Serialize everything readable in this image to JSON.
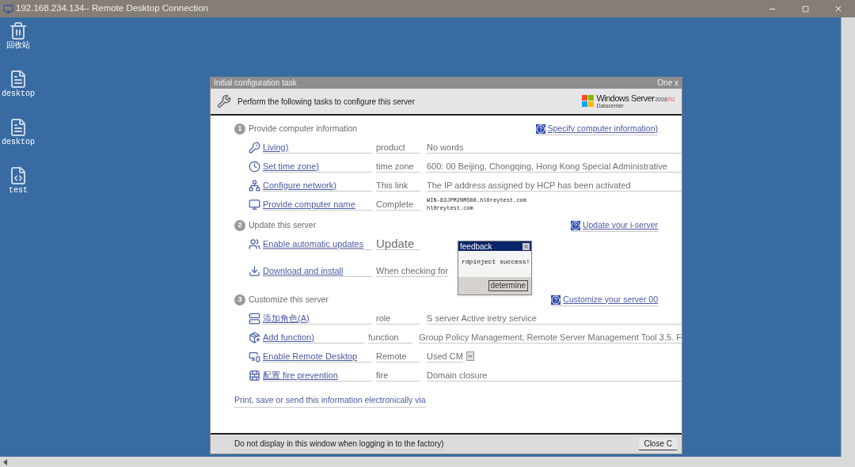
{
  "window": {
    "title": "192.168.234.134– Remote Desktop Connection"
  },
  "desktop_icons": [
    {
      "label": "回收站",
      "kind": "recycle"
    },
    {
      "label": "desktop",
      "kind": "file"
    },
    {
      "label": "desktop",
      "kind": "file"
    },
    {
      "label": "test",
      "kind": "script"
    }
  ],
  "dialog": {
    "title": "Initial configuration task",
    "close_label": "One x",
    "header_text": "Perform the following tasks to configure this server",
    "logo": {
      "brand": "Windows Server",
      "version": "2008",
      "edition": "R2",
      "sub": "Datacenter"
    },
    "sections": [
      {
        "number": "1",
        "title": "Provide computer information",
        "help_link": "Specify computer information)",
        "tasks": [
          {
            "kind": "key",
            "link": "Living)",
            "label": "product",
            "value": "No words"
          },
          {
            "kind": "clock",
            "link": "Set time zone)",
            "label": "time zone",
            "value": "600: 00 Beijing, Chongqing, Hong Kong Special Administrative"
          },
          {
            "kind": "network",
            "link": "Configure network)",
            "label": "This link",
            "value": "The IP address assigned by HCP has been activated"
          },
          {
            "kind": "computer",
            "link": "Provide computer name",
            "label": "Complete",
            "value_lines": [
              "WIN-83JPM2NMS08.hl0reytest.com",
              "hl0reytest.com"
            ]
          }
        ]
      },
      {
        "number": "2",
        "title": "Update this server",
        "help_link": "Update your i-server",
        "tasks": [
          {
            "kind": "users",
            "link": "Enable automatic updates",
            "label": "Update"
          },
          {
            "kind": "download",
            "link": "Download and install",
            "label": "When checking for"
          }
        ]
      },
      {
        "number": "3",
        "title": "Customize this server",
        "help_link": "Customize your server 00",
        "tasks": [
          {
            "kind": "roles",
            "link": "添加角色(A)",
            "label": "role",
            "value": "S server Active iretry service"
          },
          {
            "kind": "features",
            "link": "Add function)",
            "label": "function",
            "value": "Group Policy Management, Remote Server Management Tool 3.5. F"
          },
          {
            "kind": "remote",
            "link": "Enable Remote Desktop",
            "label": "Remote",
            "value": "Used CM"
          },
          {
            "kind": "firewall",
            "link": "配置 fire prevention",
            "label": "fire",
            "value": "Domain closure"
          }
        ]
      }
    ],
    "print_link": "Print, save or send this information electronically via",
    "footer_text": "Do not display in this window when logging in to the factory)",
    "close_button": "Close C"
  },
  "popup": {
    "title": "feedback",
    "message": "rdpinject success!",
    "button": "determine"
  }
}
